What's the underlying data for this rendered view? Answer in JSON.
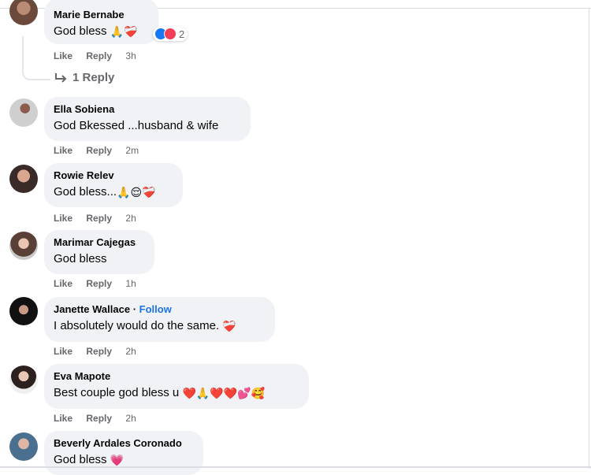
{
  "comments": [
    {
      "name": "Marie Bernabe",
      "text": "God bless",
      "emoji": "🙏❤️‍🩹",
      "reactions": {
        "count": "2"
      },
      "actions": {
        "like": "Like",
        "reply": "Reply",
        "time": "3h"
      },
      "replies_label": "1 Reply"
    },
    {
      "name": "Ella Sobiena",
      "text": "God Bkessed ...husband & wife",
      "emoji": "",
      "actions": {
        "like": "Like",
        "reply": "Reply",
        "time": "2m"
      }
    },
    {
      "name": "Rowie Relev",
      "text": "God bless...",
      "emoji": "🙏😌❤️‍🩹",
      "actions": {
        "like": "Like",
        "reply": "Reply",
        "time": "2h"
      }
    },
    {
      "name": "Marimar Cajegas",
      "text": "God bless",
      "emoji": "",
      "actions": {
        "like": "Like",
        "reply": "Reply",
        "time": "1h"
      }
    },
    {
      "name": "Janette Wallace",
      "follow": "Follow",
      "separator": "·",
      "text": "I absolutely would do the same.",
      "emoji": "❤️‍🩹",
      "actions": {
        "like": "Like",
        "reply": "Reply",
        "time": "2h"
      }
    },
    {
      "name": "Eva Mapote",
      "text": "Best couple god bless u",
      "emoji": "❤️🙏❤️❤️💕🥰",
      "actions": {
        "like": "Like",
        "reply": "Reply",
        "time": "2h"
      }
    },
    {
      "name": "Beverly Ardales Coronado",
      "text": "God bless",
      "emoji": "💗"
    }
  ],
  "colors": {
    "bubble": "#f0f2f5",
    "link": "#1b74e4",
    "meta": "#65676b",
    "like_reaction": "#1877f2",
    "love_reaction": "#f33e58"
  }
}
